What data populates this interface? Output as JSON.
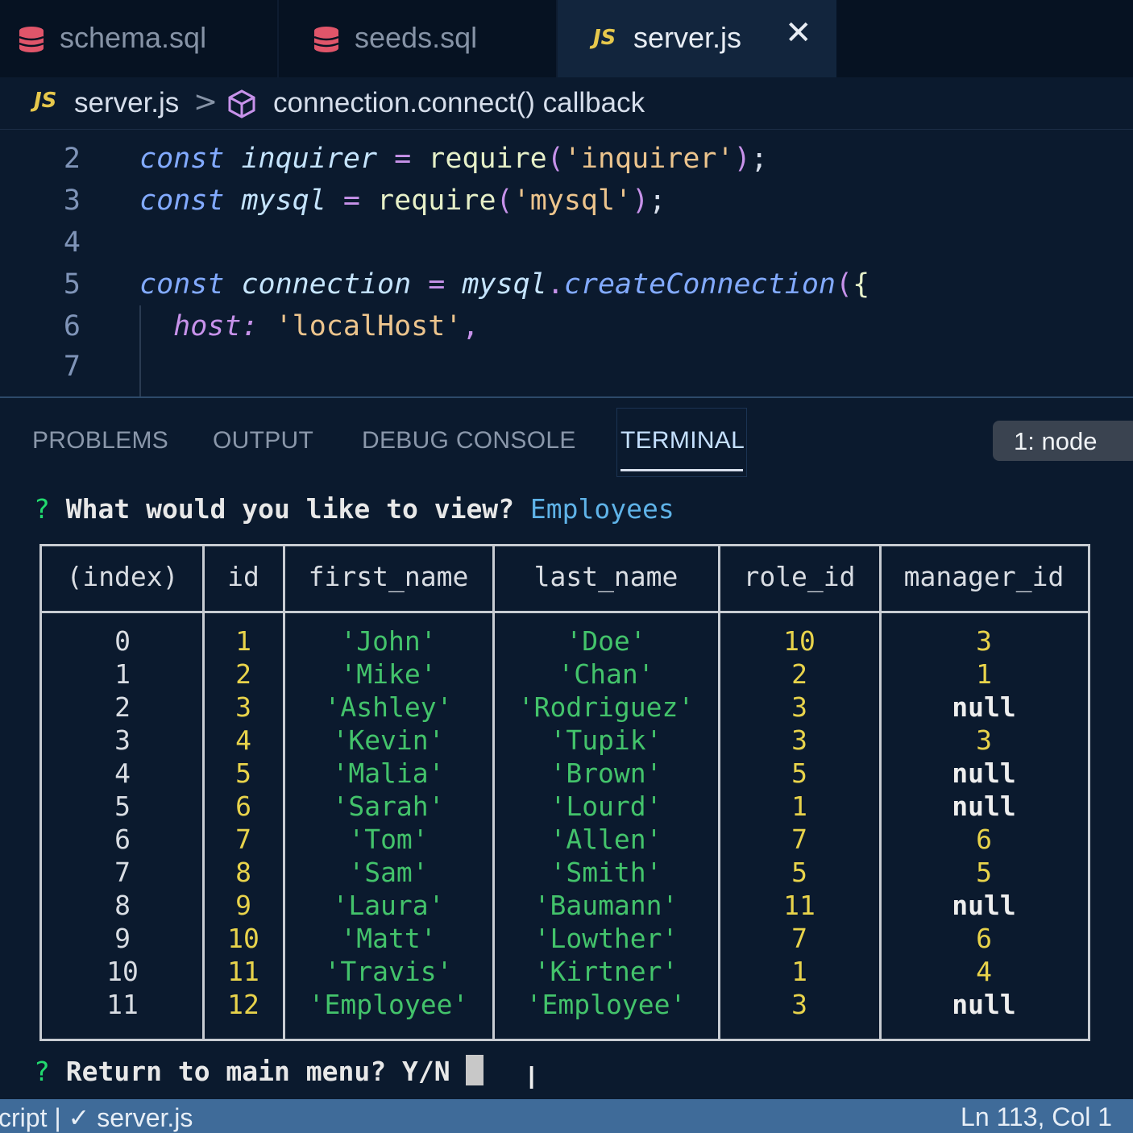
{
  "tabs": [
    {
      "label": "schema.sql",
      "icon": "database-icon"
    },
    {
      "label": "seeds.sql",
      "icon": "database-icon"
    },
    {
      "label": "server.js",
      "icon": "js-icon",
      "active": true
    }
  ],
  "breadcrumb": {
    "js_badge": "JS",
    "file": "server.js",
    "separator": ">",
    "symbol": "connection.connect() callback"
  },
  "editor": {
    "lines": [
      {
        "num": "2",
        "tokens": [
          {
            "t": "const",
            "c": "kw"
          },
          {
            "t": " ",
            "c": "plain"
          },
          {
            "t": "inquirer",
            "c": "var"
          },
          {
            "t": " ",
            "c": "plain"
          },
          {
            "t": "=",
            "c": "op"
          },
          {
            "t": " ",
            "c": "plain"
          },
          {
            "t": "require",
            "c": "fn"
          },
          {
            "t": "(",
            "c": "op"
          },
          {
            "t": "'inquirer'",
            "c": "str"
          },
          {
            "t": ")",
            "c": "op"
          },
          {
            "t": ";",
            "c": "plain"
          }
        ]
      },
      {
        "num": "3",
        "tokens": [
          {
            "t": "const",
            "c": "kw"
          },
          {
            "t": " ",
            "c": "plain"
          },
          {
            "t": "mysql",
            "c": "var"
          },
          {
            "t": " ",
            "c": "plain"
          },
          {
            "t": "=",
            "c": "op"
          },
          {
            "t": " ",
            "c": "plain"
          },
          {
            "t": "require",
            "c": "fn"
          },
          {
            "t": "(",
            "c": "op"
          },
          {
            "t": "'mysql'",
            "c": "str"
          },
          {
            "t": ")",
            "c": "op"
          },
          {
            "t": ";",
            "c": "plain"
          }
        ]
      },
      {
        "num": "4",
        "tokens": []
      },
      {
        "num": "5",
        "tokens": [
          {
            "t": "const",
            "c": "kw"
          },
          {
            "t": " ",
            "c": "plain"
          },
          {
            "t": "connection",
            "c": "var"
          },
          {
            "t": " ",
            "c": "plain"
          },
          {
            "t": "=",
            "c": "op"
          },
          {
            "t": " ",
            "c": "plain"
          },
          {
            "t": "mysql",
            "c": "var"
          },
          {
            "t": ".",
            "c": "op"
          },
          {
            "t": "createConnection",
            "c": "fnc"
          },
          {
            "t": "(",
            "c": "op"
          },
          {
            "t": "{",
            "c": "fn"
          }
        ]
      },
      {
        "num": "6",
        "tokens": [
          {
            "t": "  ",
            "c": "plain"
          },
          {
            "t": "host:",
            "c": "prop"
          },
          {
            "t": " ",
            "c": "plain"
          },
          {
            "t": "'localHost'",
            "c": "str"
          },
          {
            "t": ",",
            "c": "op"
          }
        ]
      },
      {
        "num": "7",
        "tokens": []
      }
    ]
  },
  "panel": {
    "tabs": [
      "PROBLEMS",
      "OUTPUT",
      "DEBUG CONSOLE",
      "TERMINAL"
    ],
    "active_tab": "TERMINAL",
    "terminal_select": "1: node"
  },
  "terminal": {
    "prompt1": {
      "mark": "?",
      "question": "What would you like to view?",
      "answer": "Employees"
    },
    "table": {
      "headers": [
        "(index)",
        "id",
        "first_name",
        "last_name",
        "role_id",
        "manager_id"
      ],
      "rows": [
        [
          "0",
          "1",
          "'John'",
          "'Doe'",
          "10",
          "3"
        ],
        [
          "1",
          "2",
          "'Mike'",
          "'Chan'",
          "2",
          "1"
        ],
        [
          "2",
          "3",
          "'Ashley'",
          "'Rodriguez'",
          "3",
          "null"
        ],
        [
          "3",
          "4",
          "'Kevin'",
          "'Tupik'",
          "3",
          "3"
        ],
        [
          "4",
          "5",
          "'Malia'",
          "'Brown'",
          "5",
          "null"
        ],
        [
          "5",
          "6",
          "'Sarah'",
          "'Lourd'",
          "1",
          "null"
        ],
        [
          "6",
          "7",
          "'Tom'",
          "'Allen'",
          "7",
          "6"
        ],
        [
          "7",
          "8",
          "'Sam'",
          "'Smith'",
          "5",
          "5"
        ],
        [
          "8",
          "9",
          "'Laura'",
          "'Baumann'",
          "11",
          "null"
        ],
        [
          "9",
          "10",
          "'Matt'",
          "'Lowther'",
          "7",
          "6"
        ],
        [
          "10",
          "11",
          "'Travis'",
          "'Kirtner'",
          "1",
          "4"
        ],
        [
          "11",
          "12",
          "'Employee'",
          "'Employee'",
          "3",
          "null"
        ]
      ]
    },
    "prompt2": {
      "mark": "?",
      "question": "Return to main menu? Y/N"
    }
  },
  "statusbar": {
    "left": "cript | ✓ server.js",
    "right": "Ln 113, Col 1"
  },
  "colors": {
    "background": "#0b1a2e",
    "statusbar": "#3f6b99",
    "number": "#e8d34b",
    "string": "#43c36b",
    "answer": "#5fb3e8"
  }
}
